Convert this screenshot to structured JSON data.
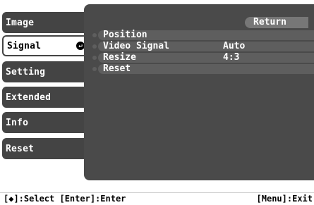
{
  "menu": {
    "items": [
      {
        "label": "Image"
      },
      {
        "label": "Signal",
        "active": true
      },
      {
        "label": "Setting"
      },
      {
        "label": "Extended"
      },
      {
        "label": "Info"
      },
      {
        "label": "Reset"
      }
    ]
  },
  "panel": {
    "return_label": "Return",
    "rows": [
      {
        "label": "Position",
        "value": ""
      },
      {
        "label": "Video Signal",
        "value": "Auto"
      },
      {
        "label": "Resize",
        "value": "4:3"
      },
      {
        "label": "Reset",
        "value": ""
      }
    ]
  },
  "statusbar": {
    "left": "[◆]:Select [Enter]:Enter",
    "right": "[Menu]:Exit"
  },
  "colors": {
    "tab": "#444444",
    "panel": "#4a4a4a",
    "row": "#5e5e5e",
    "return": "#777777"
  },
  "icons": {
    "enter": "enter-icon"
  }
}
